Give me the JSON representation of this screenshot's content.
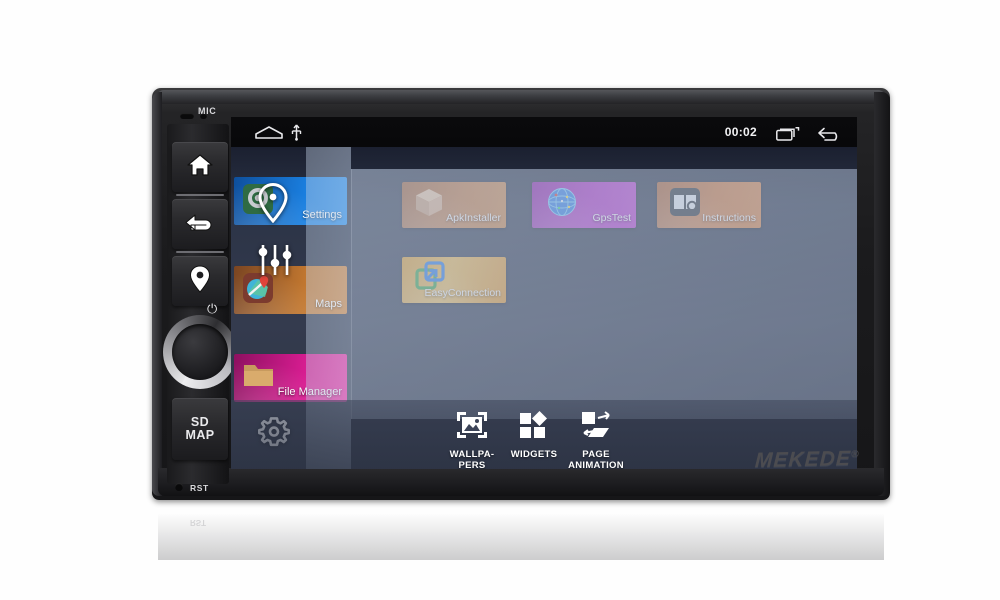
{
  "device": {
    "brand": "MEKEDE",
    "brand_mark": "®",
    "mic_label": "MIC",
    "reset_label": "RST",
    "sd_map_line1": "SD",
    "sd_map_line2": "MAP",
    "hardware_buttons": [
      {
        "name": "home-hard-button",
        "icon": "home-icon"
      },
      {
        "name": "back-hard-button",
        "icon": "back-arrow-icon"
      },
      {
        "name": "navigation-hard-button",
        "icon": "map-pin-icon"
      },
      {
        "name": "power-volume-knob",
        "icon": "power-icon"
      }
    ]
  },
  "statusbar": {
    "time": "00:02",
    "left_icons": [
      "home-outline-icon",
      "usb-icon"
    ],
    "right_icons": [
      "recents-icon",
      "back-icon"
    ]
  },
  "left_apps": [
    {
      "label": "Settings",
      "color": "#1a7fe0",
      "icon": "settings-gear-icon"
    },
    {
      "label": "Maps",
      "color": "#d0813a",
      "icon": "maps-icon"
    },
    {
      "label": "File Manager",
      "color": "#e8229a",
      "icon": "folder-icon"
    }
  ],
  "overlay_icons": [
    {
      "name": "location-pin-overlay-icon"
    },
    {
      "name": "equalizer-sliders-overlay-icon"
    },
    {
      "name": "settings-gear-overlay-icon"
    }
  ],
  "apps": [
    {
      "label": "ApkInstaller",
      "color": "#c4783c",
      "icon": "package-box-icon"
    },
    {
      "label": "GpsTest",
      "color": "#b12ec4",
      "icon": "globe-icon"
    },
    {
      "label": "Instructions",
      "color": "#d2793a",
      "icon": "book-icon"
    },
    {
      "label": "EasyConnection",
      "color": "#e8a93a",
      "icon": "screen-share-icon"
    }
  ],
  "dock": [
    {
      "label": "WALLPA-\nPERS",
      "line1": "WALLPA-",
      "line2": "PERS",
      "icon": "wallpaper-icon"
    },
    {
      "label": "WIDGETS",
      "line1": "WIDGETS",
      "line2": "",
      "icon": "widgets-icon"
    },
    {
      "label": "PAGE ANIMATION",
      "line1": "PAGE",
      "line2": "ANIMATION",
      "icon": "page-animation-icon"
    }
  ],
  "colors": {
    "accent_blue": "#1a7fe0",
    "accent_magenta": "#e8229a",
    "accent_orange": "#d2793a",
    "accent_purple": "#b12ec4",
    "screen_bg": "#2d3343"
  }
}
